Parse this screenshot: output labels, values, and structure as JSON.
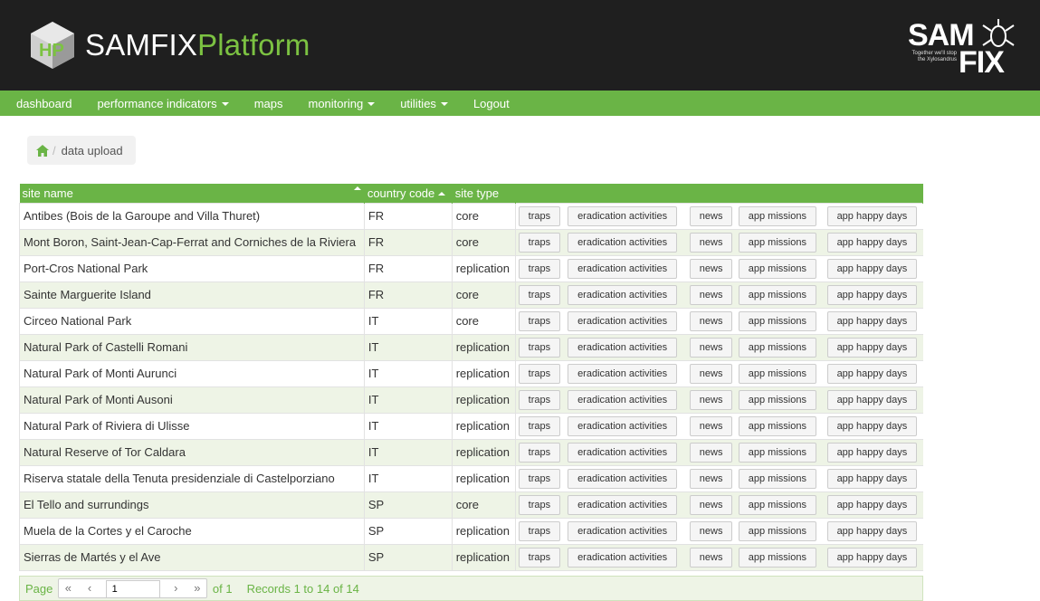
{
  "header": {
    "brand_main": "SAMFIX",
    "brand_accent": "Platform",
    "right_logo_top": "SAM",
    "right_logo_bottom": "FIX",
    "right_logo_tagline": "Together we'll stop the Xylosandrus",
    "brand_color": "#6ab446"
  },
  "nav": {
    "items": [
      {
        "label": "dashboard",
        "dropdown": false
      },
      {
        "label": "performance indicators",
        "dropdown": true
      },
      {
        "label": "maps",
        "dropdown": false
      },
      {
        "label": "monitoring",
        "dropdown": true
      },
      {
        "label": "utilities",
        "dropdown": true
      },
      {
        "label": "Logout",
        "dropdown": false
      }
    ]
  },
  "breadcrumb": {
    "icon": "home-icon",
    "separator": "/",
    "current": "data upload"
  },
  "table": {
    "headers": {
      "site_name": "site name",
      "country_code": "country code",
      "site_type": "site type"
    },
    "action_labels": {
      "traps": "traps",
      "eradication": "eradication activities",
      "news": "news",
      "missions": "app missions",
      "happy_days": "app happy days"
    },
    "rows": [
      {
        "site": "Antibes (Bois de la Garoupe and Villa Thuret)",
        "country": "FR",
        "type": "core"
      },
      {
        "site": "Mont Boron, Saint-Jean-Cap-Ferrat and Corniches de la Riviera",
        "country": "FR",
        "type": "core"
      },
      {
        "site": "Port-Cros National Park",
        "country": "FR",
        "type": "replication"
      },
      {
        "site": "Sainte Marguerite Island",
        "country": "FR",
        "type": "core"
      },
      {
        "site": "Circeo National Park",
        "country": "IT",
        "type": "core"
      },
      {
        "site": "Natural Park of Castelli Romani",
        "country": "IT",
        "type": "replication"
      },
      {
        "site": "Natural Park of Monti Aurunci",
        "country": "IT",
        "type": "replication"
      },
      {
        "site": "Natural Park of Monti Ausoni",
        "country": "IT",
        "type": "replication"
      },
      {
        "site": "Natural Park of Riviera di Ulisse",
        "country": "IT",
        "type": "replication"
      },
      {
        "site": "Natural Reserve of Tor Caldara",
        "country": "IT",
        "type": "replication"
      },
      {
        "site": "Riserva statale della Tenuta presidenziale di Castelporziano",
        "country": "IT",
        "type": "replication"
      },
      {
        "site": "El Tello and surrundings",
        "country": "SP",
        "type": "core"
      },
      {
        "site": "Muela de la Cortes y el Caroche",
        "country": "SP",
        "type": "replication"
      },
      {
        "site": "Sierras de Martés y el Ave",
        "country": "SP",
        "type": "replication"
      }
    ]
  },
  "pager": {
    "page_label": "Page",
    "first": "«",
    "prev": "‹",
    "current": "1",
    "next": "›",
    "last": "»",
    "of_label": "of 1",
    "records": "Records 1 to 14 of 14"
  }
}
